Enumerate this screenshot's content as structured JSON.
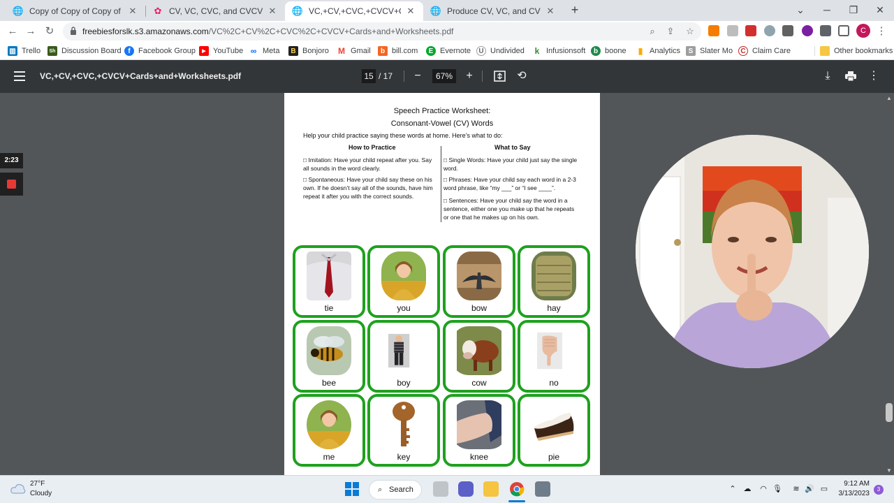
{
  "browser": {
    "tabs": [
      {
        "title": "Copy of Copy of Copy of Dear Ca",
        "active": false
      },
      {
        "title": "CV, VC, CVC, and CVCV Words | F",
        "active": false
      },
      {
        "title": "VC,+CV,+CVC,+CVCV+Cards+and",
        "active": true
      },
      {
        "title": "Produce CV, VC, and CVC Words",
        "active": false
      }
    ],
    "url_host": "freebiesforslk.s3.amazonaws.com",
    "url_path": "/VC%2C+CV%2C+CVC%2C+CVCV+Cards+and+Worksheets.pdf",
    "profile_initial": "C"
  },
  "bookmarks": [
    {
      "label": "Trello",
      "color": "#0079bf",
      "glyph": "▥"
    },
    {
      "label": "Discussion Board",
      "color": "#3a5a1c",
      "glyph": "Sh"
    },
    {
      "label": "Facebook Group",
      "color": "#1877f2",
      "glyph": "f"
    },
    {
      "label": "YouTube",
      "color": "#ff0000",
      "glyph": "▶"
    },
    {
      "label": "Meta",
      "color": "#0866ff",
      "glyph": "∞"
    },
    {
      "label": "Bonjoro",
      "color": "#222222",
      "glyph": "B"
    },
    {
      "label": "Gmail",
      "color": "#ea4335",
      "glyph": "M"
    },
    {
      "label": "bill.com",
      "color": "#f26722",
      "glyph": "b"
    },
    {
      "label": "Evernote",
      "color": "#00a82d",
      "glyph": "E"
    },
    {
      "label": "Undivided",
      "color": "#6b6b6b",
      "glyph": "U"
    },
    {
      "label": "Infusionsoft",
      "color": "#2e8b2e",
      "glyph": "k"
    },
    {
      "label": "boone",
      "color": "#1e8a4c",
      "glyph": "b"
    },
    {
      "label": "Analytics",
      "color": "#f9ab00",
      "glyph": "▮"
    },
    {
      "label": "Slater Mo",
      "color": "#9e9e9e",
      "glyph": "S"
    },
    {
      "label": "Claim Care",
      "color": "#c62828",
      "glyph": "C"
    },
    {
      "label": "Other bookmarks",
      "color": "#f6c744",
      "glyph": "▭"
    }
  ],
  "pdf": {
    "filename": "VC,+CV,+CVC,+CVCV+Cards+and+Worksheets.pdf",
    "current_page": "15",
    "total_pages": "17",
    "zoom": "67%"
  },
  "worksheet": {
    "title": "Speech Practice Worksheet:",
    "subtitle": "Consonant-Vowel (CV) Words",
    "intro": "Help your child practice saying these words at home.  Here’s what to do:",
    "col_left_heading": "How to Practice",
    "col_right_heading": "What to Say",
    "left_items": [
      "Imitation: Have your child repeat after you. Say all sounds in the word clearly.",
      "Spontaneous: Have your child say these on his own. If he doesn’t say all of the sounds,  have him repeat it after you with the correct sounds."
    ],
    "right_items": [
      "Single Words: Have your child just say the single word.",
      "Phrases: Have your child say each word in a 2-3 word phrase, like “my ___” or “I see ____”.",
      "Sentences: Have your child say the word in a sentence, either one you make up that he repeats or one that he makes up on his own."
    ],
    "cards": [
      {
        "word": "tie",
        "picture": "tie-photo"
      },
      {
        "word": "you",
        "picture": "woman-photo"
      },
      {
        "word": "bow",
        "picture": "bow-photo"
      },
      {
        "word": "hay",
        "picture": "hay-photo"
      },
      {
        "word": "bee",
        "picture": "bee-photo"
      },
      {
        "word": "boy",
        "picture": "boy-photo"
      },
      {
        "word": "cow",
        "picture": "cow-photo"
      },
      {
        "word": "no",
        "picture": "thumbs-down-photo"
      },
      {
        "word": "me",
        "picture": "woman-photo"
      },
      {
        "word": "key",
        "picture": "key-photo"
      },
      {
        "word": "knee",
        "picture": "knee-photo"
      },
      {
        "word": "pie",
        "picture": "pie-photo"
      }
    ]
  },
  "recorder": {
    "elapsed": "2:23"
  },
  "taskbar": {
    "temperature": "27°F",
    "condition": "Cloudy",
    "search_label": "Search",
    "time": "9:12 AM",
    "date": "3/13/2023",
    "notifications": "3"
  },
  "colors": {
    "card_border": "#1ea11e",
    "pdf_toolbar": "#323639",
    "viewer_bg": "#525659"
  }
}
